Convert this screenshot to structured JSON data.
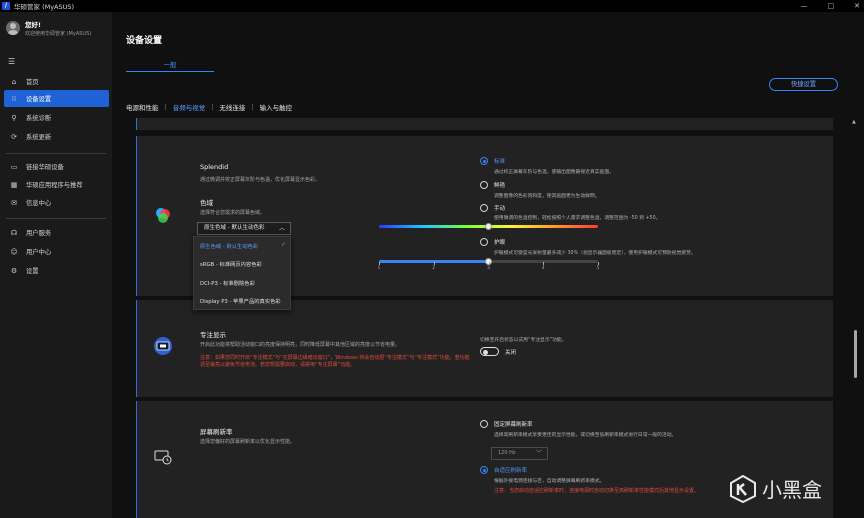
{
  "window": {
    "app_title": "华硕管家 (MyASUS)",
    "controls": [
      "—",
      "□",
      "✕"
    ]
  },
  "sidebar": {
    "greeting": "您好!",
    "welcome": "欢迎使用华硕管家 (MyASUS)",
    "items": [
      {
        "label": "首页",
        "icon": "home-icon"
      },
      {
        "label": "设备设置",
        "icon": "settings-grid-icon",
        "active": true
      },
      {
        "label": "系统诊断",
        "icon": "diagnosis-icon"
      },
      {
        "label": "系统更新",
        "icon": "update-icon"
      },
      {
        "label": "链接华硕设备",
        "icon": "link-device-icon"
      },
      {
        "label": "华硕应用程序与推荐",
        "icon": "apps-icon"
      },
      {
        "label": "信息中心",
        "icon": "message-icon"
      },
      {
        "label": "用户服务",
        "icon": "headset-icon"
      },
      {
        "label": "用户中心",
        "icon": "user-icon"
      },
      {
        "label": "设置",
        "icon": "gear-icon"
      }
    ]
  },
  "main": {
    "title": "设备设置",
    "tab_general": "一般",
    "quick_settings": "快捷设置",
    "subtabs": [
      "电源和性能",
      "音频与视觉",
      "无线连接",
      "输入与触控"
    ],
    "active_subtab": 1
  },
  "splendid": {
    "title": "Splendid",
    "desc": "通过微调并校正屏幕灰阶与色温，优化屏幕显示色彩。",
    "gamut_title": "色域",
    "gamut_desc": "选择符合您需求的屏幕色域。",
    "gamut_selected": "原生色域 - 默认生动色彩",
    "gamut_options": [
      "原生色域 - 默认生动色彩",
      "sRGB - 标准网页内容色彩",
      "DCI-P3 - 标准剧院色彩",
      "Display P3 - 苹果产品的真实色彩"
    ],
    "modes": [
      {
        "label": "标准",
        "desc": "通过校正屏幕灰阶与色温，使输出图像最接近真实画面。",
        "selected": true
      },
      {
        "label": "鲜艳",
        "desc": "调整图像的色彩饱和度，使其画面更为生动鲜明。"
      },
      {
        "label": "手动",
        "desc": "使用微调的色温控制，轻松按照个人需求调整色温，调整范围为 -50 到 +50。"
      },
      {
        "label": "护眼",
        "desc": "护眼模式可使蓝光发射量最多减少 30%（视显示器面板而定），使用护眼模式可预防视觉疲劳。"
      }
    ],
    "manual_value": 0,
    "eyecare_level": 3,
    "eyecare_ticks": [
      "1",
      "2",
      "3",
      "4",
      "5"
    ]
  },
  "focus": {
    "title": "专注显示",
    "desc": "开启此功能将帮助活动窗口的亮度保持明亮，同时降低屏幕中其他区域的亮度以节省电量。",
    "warn": "注意：如果您同时开启“专注模式”与“在屏幕边缘暗淡窗口”，Windows 将会自动把“专注模式”与“专注模式”功能，若功能调至最亮以避免节省电池。若您想需要启动，请禁用“专注屏幕”功能。",
    "toggle_desc": "切换至开启状态以试用“专注显示”功能。",
    "toggle_label": "关闭",
    "toggle_on": false
  },
  "refresh": {
    "title": "屏幕刷新率",
    "desc": "选择您偏好的屏幕刷新率以优化显示性能。",
    "fixed_label": "固定屏幕刷新率",
    "fixed_desc": "选择高刷新率模式享受更佳的显示性能，或切换至低刷新率模式进行日常一般的活动。",
    "hz_value": "120 Hz",
    "adaptive_label": "自适应刷新率",
    "adaptive_desc": "根据外接电源连接与否，自动调整屏幕刷新率模式。",
    "adaptive_warn": "注意：当您启动自适应刷新率时，连接电源时自动切换至高刷新率性能模式后其他显示设置。",
    "selected": "adaptive"
  },
  "colors": {
    "accent": "#3b82f6",
    "active_nav": "#1e62d6",
    "warning": "#e14c3c"
  },
  "watermark": "小黑盒"
}
